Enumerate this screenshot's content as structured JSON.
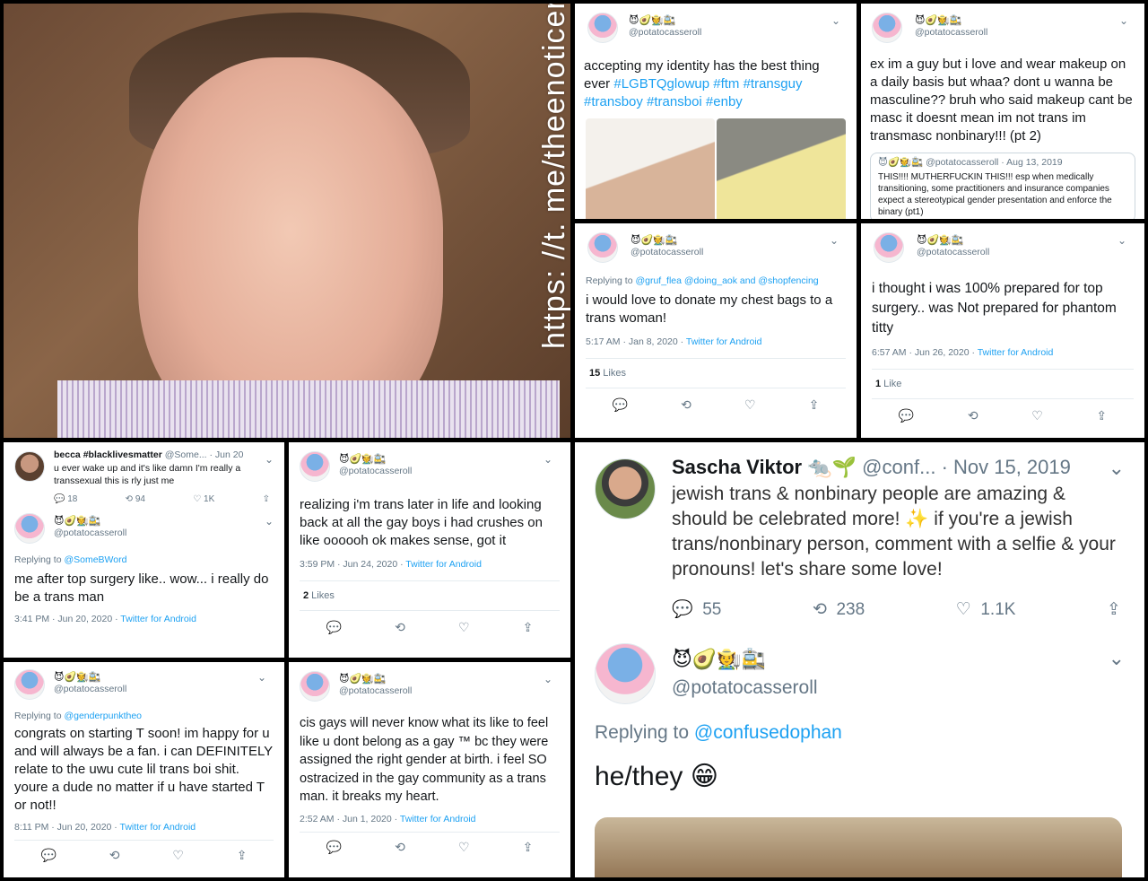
{
  "photo": {
    "watermark": "https: //t. me/theenoticer"
  },
  "t1": {
    "emojis": "😈🥑🧑‍🌾🚉",
    "handle": "@potatocasseroll",
    "text_a": "accepting my identity has the best thing ever ",
    "tags": "#LGBTQglowup #ftm #transguy #transboy #transboi #enby"
  },
  "t2": {
    "emojis": "😈🥑🧑‍🌾🚉",
    "handle": "@potatocasseroll",
    "text": "ex im a guy but i love and wear makeup on a daily basis but whaa? dont u wanna be masculine?? bruh who said makeup cant be masc it doesnt mean im not trans im transmasc nonbinary!!! (pt 2)",
    "quote_head": "😈🥑🧑‍🌾🚉 @potatocasseroll · Aug 13, 2019",
    "quote_text": "THIS!!!! MUTHERFUCKIN THIS!!! esp when medically transitioning, some practitioners and insurance companies expect a stereotypical gender presentation and enforce the binary (pt1)"
  },
  "t3": {
    "emojis": "😈🥑🧑‍🌾🚉",
    "handle": "@potatocasseroll",
    "replying_prefix": "Replying to ",
    "replying_to": "@gruf_flea @doing_aok and @shopfencing",
    "text": "i would love to donate my chest bags to a trans woman!",
    "time": "5:17 AM · Jan 8, 2020 · ",
    "client": "Twitter for Android",
    "likes_count": "15",
    "likes_label": " Likes"
  },
  "t4": {
    "emojis": "😈🥑🧑‍🌾🚉",
    "handle": "@potatocasseroll",
    "text": "i thought i was 100% prepared for top surgery.. was Not prepared for phantom titty",
    "time": "6:57 AM · Jun 26, 2020 · ",
    "client": "Twitter for Android",
    "likes_count": "1",
    "likes_label": " Like"
  },
  "t5": {
    "orig_name": "becca #blacklivesmatter",
    "orig_handle": "@Some... · Jun 20",
    "orig_text": "u ever wake up and it's like damn I'm really a transsexual this is rly just me",
    "orig_replies": "18",
    "orig_rts": "94",
    "orig_likes": "1K",
    "emojis": "😈🥑🧑‍🌾🚉",
    "handle": "@potatocasseroll",
    "replying_prefix": "Replying to ",
    "replying_to": "@SomeBWord",
    "text": "me after top surgery like.. wow... i really do be a trans man",
    "time": "3:41 PM · Jun 20, 2020 · ",
    "client": "Twitter for Android"
  },
  "t6": {
    "emojis": "😈🥑🧑‍🌾🚉",
    "handle": "@potatocasseroll",
    "text": "realizing i'm trans later in life and looking back at all the gay boys i had crushes on like oooooh ok makes sense, got it",
    "time": "3:59 PM · Jun 24, 2020 · ",
    "client": "Twitter for Android",
    "likes_count": "2",
    "likes_label": " Likes"
  },
  "t7": {
    "emojis": "😈🥑🧑‍🌾🚉",
    "handle": "@potatocasseroll",
    "replying_prefix": "Replying to ",
    "replying_to": "@genderpunktheo",
    "text": "congrats on starting T soon! im happy for u and will always be a fan. i can DEFINITELY relate to the uwu cute lil trans boi shit. youre a dude no matter if u have started T or not!!",
    "time": "8:11 PM · Jun 20, 2020 · ",
    "client": "Twitter for Android"
  },
  "t8": {
    "emojis": "😈🥑🧑‍🌾🚉",
    "handle": "@potatocasseroll",
    "text": "cis gays will never know what its like to feel like u dont belong as a gay ™ bc they were assigned the right gender at birth. i feel SO ostracized in the gay community as a trans man. it breaks my heart.",
    "time": "2:52 AM · Jun 1, 2020 · ",
    "client": "Twitter for Android"
  },
  "t9": {
    "orig_name": "Sascha Viktor",
    "orig_emoji": "🐀🌱",
    "orig_handle": "@conf...",
    "orig_date": "· Nov 15, 2019",
    "orig_text": "jewish trans & nonbinary people are amazing & should be celebrated more! ✨ if you're a jewish trans/nonbinary person, comment with a selfie & your pronouns! let's share some love!",
    "orig_replies": "55",
    "orig_rts": "238",
    "orig_likes": "1.1K",
    "emojis": "😈🥑🧑‍🌾🚉",
    "handle": "@potatocasseroll",
    "replying_prefix": "Replying to ",
    "replying_to": "@confusedophan",
    "text": "he/they 😁"
  },
  "icons": {
    "reply": "💬",
    "retweet": "⟲",
    "like": "♡",
    "share": "⇪",
    "chevron": "⌄"
  }
}
